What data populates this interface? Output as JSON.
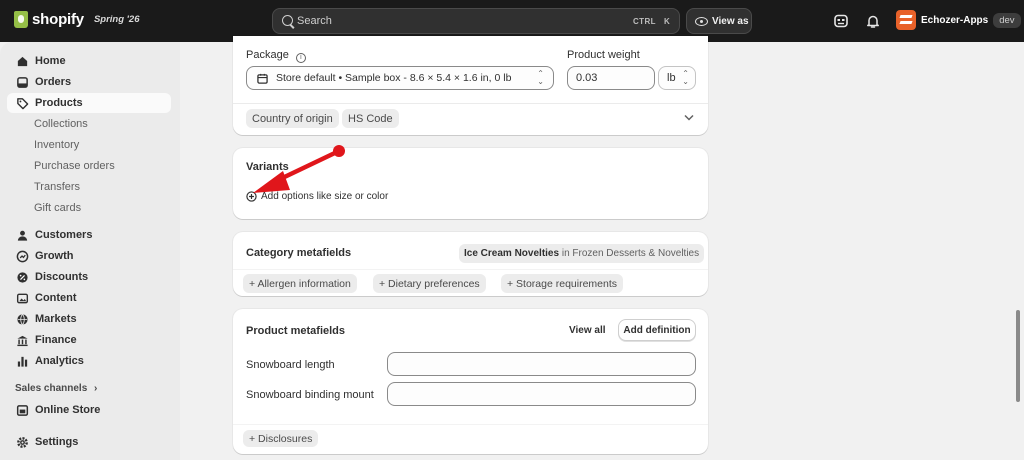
{
  "topbar": {
    "brand": "shopify",
    "season": "Spring '26",
    "search_placeholder": "Search",
    "search_kbd_1": "CTRL",
    "search_kbd_2": "K",
    "view_as_label": "View as",
    "store_name": "Echozer-Apps",
    "store_badge": "dev"
  },
  "sidebar": {
    "items": [
      {
        "label": "Home",
        "icon": "home-icon"
      },
      {
        "label": "Orders",
        "icon": "orders-icon"
      },
      {
        "label": "Products",
        "icon": "tag-icon",
        "active": true
      }
    ],
    "product_sub": [
      "Collections",
      "Inventory",
      "Purchase orders",
      "Transfers",
      "Gift cards"
    ],
    "items2": [
      {
        "label": "Customers",
        "icon": "person-icon"
      },
      {
        "label": "Growth",
        "icon": "growth-icon"
      },
      {
        "label": "Discounts",
        "icon": "discount-icon"
      },
      {
        "label": "Content",
        "icon": "content-icon"
      },
      {
        "label": "Markets",
        "icon": "globe-icon"
      },
      {
        "label": "Finance",
        "icon": "bank-icon"
      },
      {
        "label": "Analytics",
        "icon": "bar-chart-icon"
      }
    ],
    "sales_channels": "Sales channels",
    "online_store": "Online Store",
    "settings": "Settings"
  },
  "shipping": {
    "package_label": "Package",
    "package_value": "Store default • Sample box - 8.6 × 5.4 × 1.6 in, 0 lb",
    "weight_label": "Product weight",
    "weight_value": "0.03",
    "weight_unit": "lb",
    "country_chip": "Country of origin",
    "hs_chip": "HS Code"
  },
  "variants": {
    "title": "Variants",
    "add_options": "Add options like size or color"
  },
  "category_metafields": {
    "title": "Category metafields",
    "category_name": "Ice Cream Novelties",
    "category_path": "in Frozen Desserts & Novelties",
    "chips": [
      "+ Allergen information",
      "+ Dietary preferences",
      "+ Storage requirements"
    ]
  },
  "product_metafields": {
    "title": "Product metafields",
    "view_all": "View all",
    "add_definition": "Add definition",
    "fields": [
      {
        "label": "Snowboard length",
        "value": ""
      },
      {
        "label": "Snowboard binding mount",
        "value": ""
      }
    ],
    "disclosures_chip": "+ Disclosures"
  },
  "colors": {
    "topbar": "#1a1a1a",
    "annotation_arrow": "#e0161b",
    "brand_green": "#95bf47",
    "store_orange": "#e8622a"
  }
}
